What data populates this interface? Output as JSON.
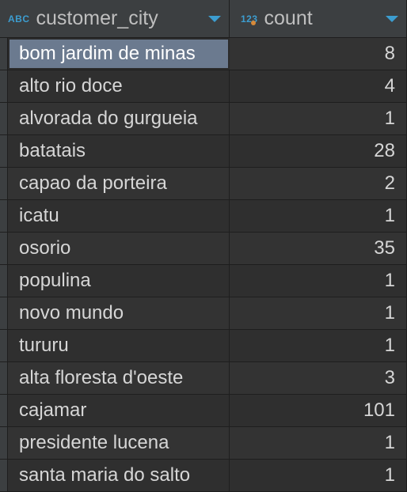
{
  "chart_data": {
    "type": "table",
    "columns": [
      "customer_city",
      "count"
    ],
    "rows": [
      [
        "bom jardim de minas",
        8
      ],
      [
        "alto rio doce",
        4
      ],
      [
        "alvorada do gurgueia",
        1
      ],
      [
        "batatais",
        28
      ],
      [
        "capao da porteira",
        2
      ],
      [
        "icatu",
        1
      ],
      [
        "osorio",
        35
      ],
      [
        "populina",
        1
      ],
      [
        "novo mundo",
        1
      ],
      [
        "tururu",
        1
      ],
      [
        "alta floresta d'oeste",
        3
      ],
      [
        "cajamar",
        101
      ],
      [
        "presidente lucena",
        1
      ],
      [
        "santa maria do salto",
        1
      ]
    ]
  },
  "columns": {
    "city": {
      "label": "customer_city",
      "type_badge": "ABC"
    },
    "count": {
      "label": "count",
      "type_badge": "123"
    }
  },
  "rows": [
    {
      "city": "bom jardim de minas",
      "count": "8",
      "selected": true
    },
    {
      "city": "alto rio doce",
      "count": "4"
    },
    {
      "city": "alvorada do gurgueia",
      "count": "1"
    },
    {
      "city": "batatais",
      "count": "28"
    },
    {
      "city": "capao da porteira",
      "count": "2"
    },
    {
      "city": "icatu",
      "count": "1"
    },
    {
      "city": "osorio",
      "count": "35"
    },
    {
      "city": "populina",
      "count": "1"
    },
    {
      "city": "novo mundo",
      "count": "1"
    },
    {
      "city": "tururu",
      "count": "1"
    },
    {
      "city": "alta floresta d'oeste",
      "count": "3"
    },
    {
      "city": "cajamar",
      "count": "101"
    },
    {
      "city": "presidente lucena",
      "count": "1"
    },
    {
      "city": "santa maria do salto",
      "count": "1"
    }
  ]
}
